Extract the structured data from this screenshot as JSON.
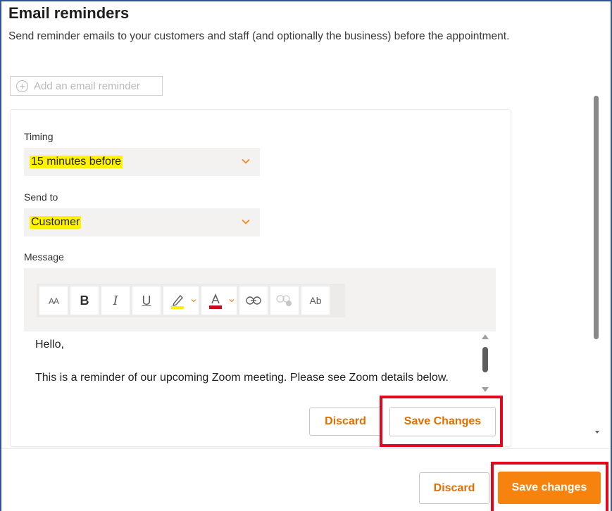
{
  "header": {
    "title": "Email reminders",
    "description": "Send reminder emails to your customers and staff (and optionally the business) before the appointment."
  },
  "add_reminder": {
    "label": "Add an email reminder",
    "icon": "plus-circle-icon"
  },
  "reminder": {
    "timing": {
      "label": "Timing",
      "value": "15 minutes before",
      "icon": "chevron-down-icon"
    },
    "send_to": {
      "label": "Send to",
      "value": "Customer",
      "icon": "chevron-down-icon"
    },
    "message": {
      "label": "Message",
      "toolbar": [
        {
          "name": "font-size-icon",
          "glyph": "AA"
        },
        {
          "name": "bold-icon",
          "glyph": "B"
        },
        {
          "name": "italic-icon",
          "glyph": "I"
        },
        {
          "name": "underline-icon",
          "glyph": "U"
        },
        {
          "name": "highlight-icon",
          "color": "#fff200"
        },
        {
          "name": "font-color-icon",
          "color": "#c50f1f"
        },
        {
          "name": "link-icon"
        },
        {
          "name": "unlink-icon"
        },
        {
          "name": "clear-format-icon",
          "glyph": "Ab"
        }
      ],
      "body_line1": "Hello,",
      "body_line2": "This is a reminder of our upcoming Zoom meeting. Please see Zoom details below."
    },
    "discard_label": "Discard",
    "save_label": "Save Changes"
  },
  "footer": {
    "discard_label": "Discard",
    "save_label": "Save changes"
  },
  "colors": {
    "accent": "#f7830f",
    "accent_text": "#e56d00",
    "highlight": "#fff200",
    "annotation_red": "#e3081d",
    "frame_blue": "#2f5597"
  }
}
